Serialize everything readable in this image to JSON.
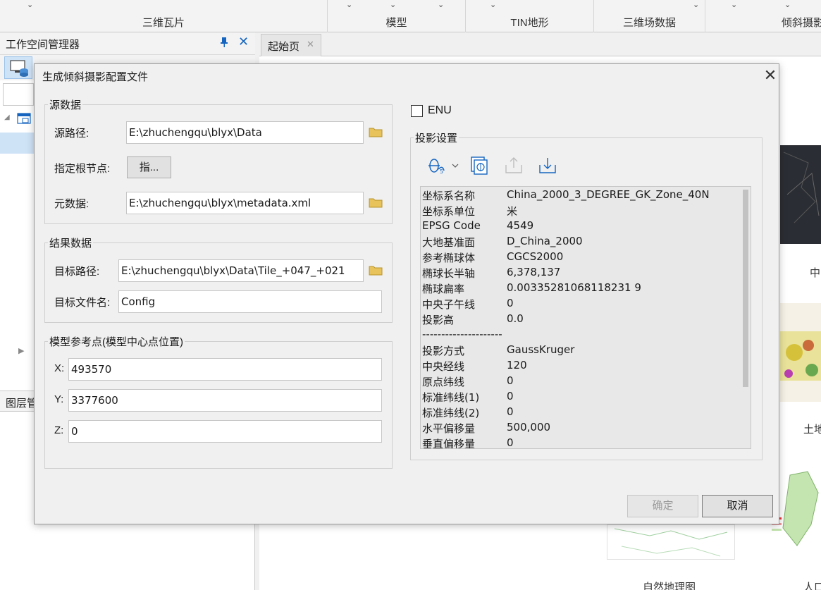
{
  "ribbon": {
    "groups": [
      {
        "label": "三维瓦片"
      },
      {
        "label": "模型"
      },
      {
        "label": "TIN地形"
      },
      {
        "label": "三维场数据"
      },
      {
        "label": "倾斜摄影"
      }
    ]
  },
  "workspace": {
    "title": "工作空间管理器",
    "layer_tab": "图层管"
  },
  "doc_tab": {
    "label": "起始页"
  },
  "start_page": {
    "thumb_labels": [
      "中",
      "土地",
      "自然地理图",
      "人口"
    ]
  },
  "dialog": {
    "title": "生成倾斜摄影配置文件",
    "source": {
      "legend": "源数据",
      "path_label": "源路径:",
      "path_value": "E:\\zhuchengqu\\blyx\\Data",
      "root_label": "指定根节点:",
      "root_button": "指...",
      "meta_label": "元数据:",
      "meta_value": "E:\\zhuchengqu\\blyx\\metadata.xml"
    },
    "result": {
      "legend": "结果数据",
      "target_label": "目标路径:",
      "target_value": "E:\\zhuchengqu\\blyx\\Data\\Tile_+047_+021",
      "name_label": "目标文件名:",
      "name_value": "Config"
    },
    "ref_point": {
      "legend": "模型参考点(模型中心点位置)",
      "x_label": "X:",
      "x_value": "493570",
      "y_label": "Y:",
      "y_value": "3377600",
      "z_label": "Z:",
      "z_value": "0"
    },
    "enu_label": "ENU",
    "enu_checked": false,
    "projection": {
      "legend": "投影设置",
      "rows": [
        {
          "k": "坐标系名称",
          "v": "China_2000_3_DEGREE_GK_Zone_40N"
        },
        {
          "k": "坐标系单位",
          "v": "米"
        },
        {
          "k": "EPSG Code",
          "v": "4549"
        },
        {
          "k": "大地基准面",
          "v": "D_China_2000"
        },
        {
          "k": "参考椭球体",
          "v": "CGCS2000"
        },
        {
          "k": "椭球长半轴",
          "v": "6,378,137"
        },
        {
          "k": "椭球扁率",
          "v": "0.00335281068118231 9"
        },
        {
          "k": "中央子午线",
          "v": "0"
        },
        {
          "k": "投影高",
          "v": "0.0"
        }
      ],
      "separator": "---------------------",
      "rows2": [
        {
          "k": "投影方式",
          "v": "GaussKruger"
        },
        {
          "k": "中央经线",
          "v": "120"
        },
        {
          "k": "原点纬线",
          "v": "0"
        },
        {
          "k": "标准纬线(1)",
          "v": "0"
        },
        {
          "k": "标准纬线(2)",
          "v": "0"
        },
        {
          "k": "水平偏移量",
          "v": "500,000"
        },
        {
          "k": "垂直偏移量",
          "v": "0"
        }
      ]
    },
    "ok_label": "确定",
    "cancel_label": "取消"
  },
  "colors": {
    "accent": "#1565c0",
    "selection": "#cfe3f7",
    "folder": "#e8c25a"
  }
}
